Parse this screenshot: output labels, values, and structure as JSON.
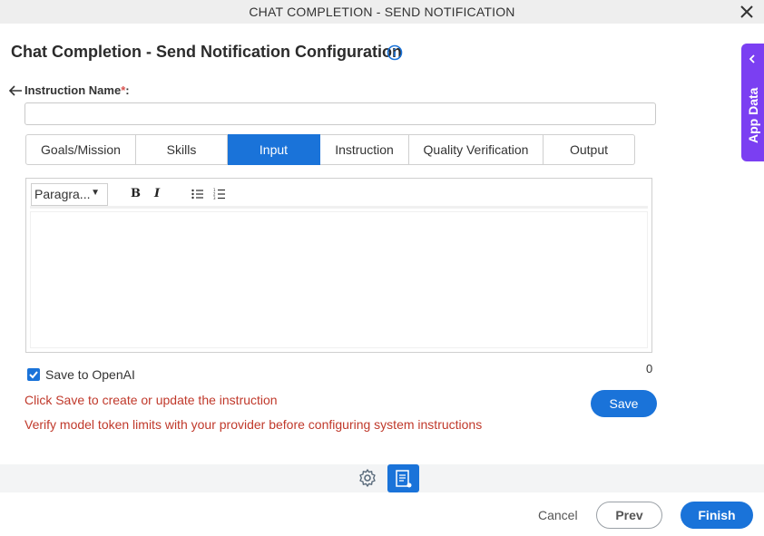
{
  "window": {
    "title": "CHAT COMPLETION - SEND NOTIFICATION",
    "close_icon": "close-icon"
  },
  "page": {
    "title": "Chat Completion - Send Notification Configuration",
    "info_icon": "info-icon"
  },
  "side_panel": {
    "label": "App Data",
    "color": "#7b3ff2"
  },
  "form": {
    "instruction_name_label": "Instruction Name",
    "required_mark": "*",
    "label_suffix": ":",
    "instruction_name_value": ""
  },
  "tabs": [
    {
      "label": "Goals/Mission",
      "active": false
    },
    {
      "label": "Skills",
      "active": false
    },
    {
      "label": "Input",
      "active": true
    },
    {
      "label": "Instruction",
      "active": false
    },
    {
      "label": "Quality Verification",
      "active": false
    },
    {
      "label": "Output",
      "active": false
    }
  ],
  "editor": {
    "paragraph_select": "Paragra...",
    "bold": "B",
    "italic": "I",
    "content": ""
  },
  "save_to_openai": {
    "label": "Save to OpenAI",
    "checked": true
  },
  "char_count": "0",
  "messages": {
    "save_hint": "Click Save to create or update the instruction",
    "token_warning": "Verify model token limits with your provider before configuring system instructions"
  },
  "buttons": {
    "save": "Save",
    "cancel": "Cancel",
    "prev": "Prev",
    "finish": "Finish"
  },
  "colors": {
    "accent": "#1a73d9",
    "error": "#c0392b"
  }
}
